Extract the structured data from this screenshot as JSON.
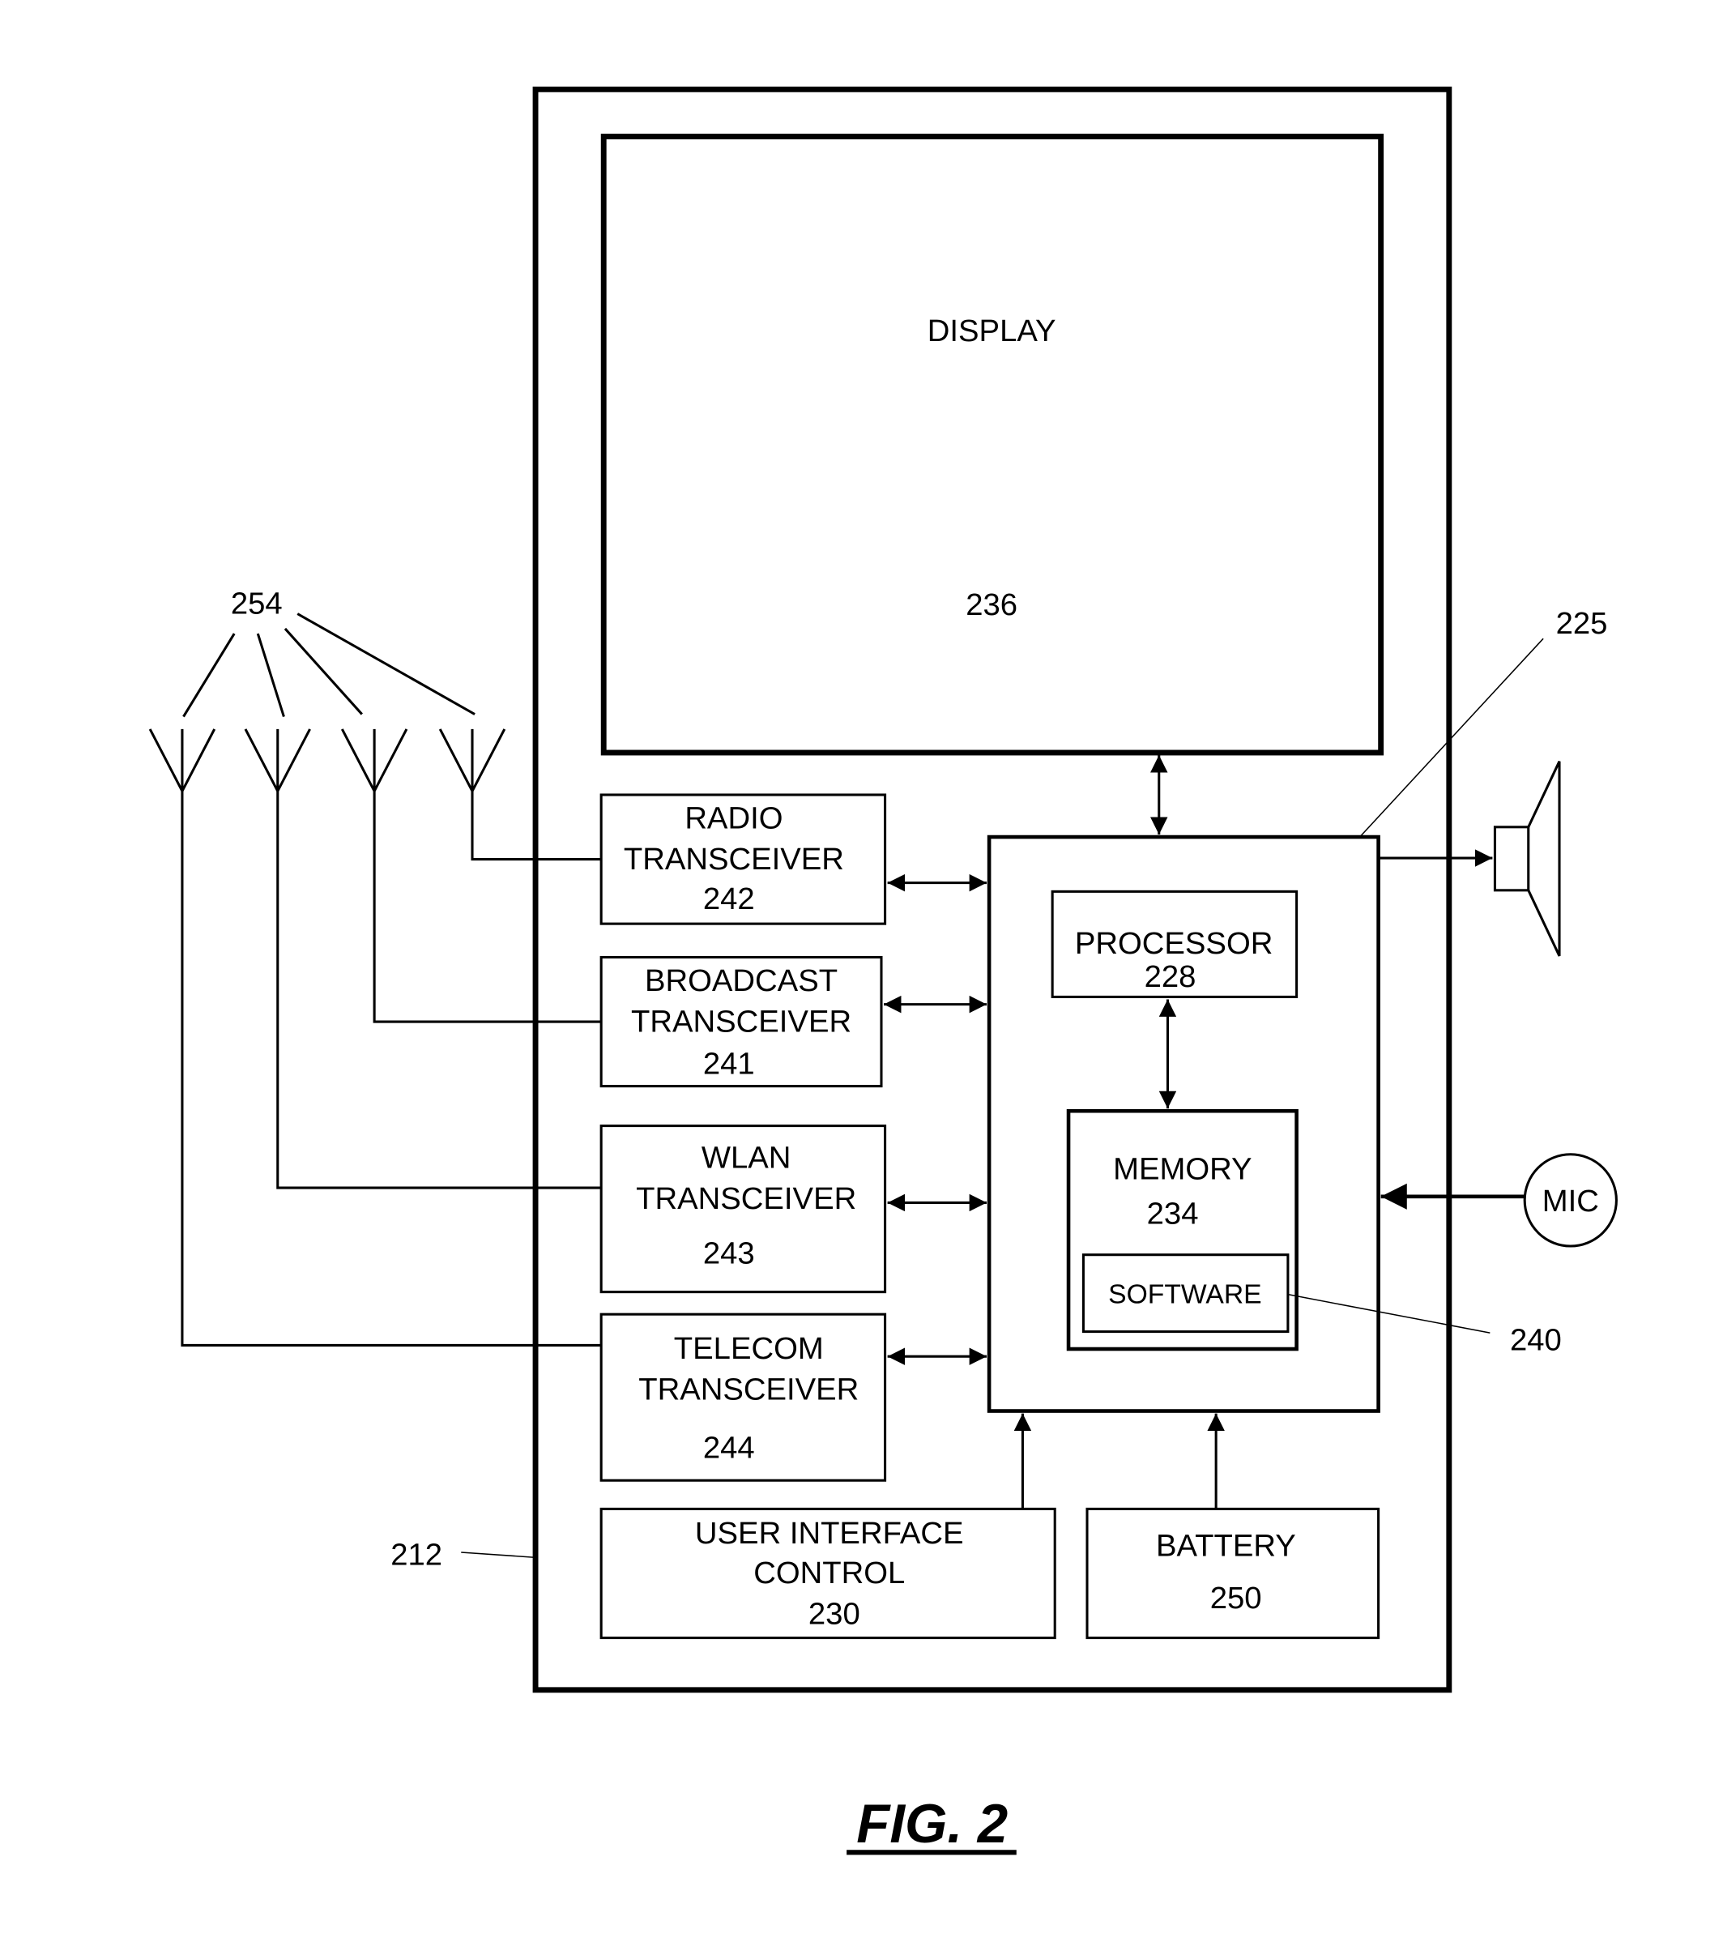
{
  "figure": {
    "caption": "FIG. 2",
    "device_ref": "212",
    "main_ref": "225",
    "antenna_ref": "254",
    "software_ref": "240"
  },
  "blocks": {
    "display": {
      "label": "DISPLAY",
      "ref": "236"
    },
    "radio": {
      "line1": "RADIO",
      "line2": "TRANSCEIVER",
      "ref": "242"
    },
    "broadcast": {
      "line1": "BROADCAST",
      "line2": "TRANSCEIVER",
      "ref": "241"
    },
    "wlan": {
      "line1": "WLAN",
      "line2": "TRANSCEIVER",
      "ref": "243"
    },
    "telecom": {
      "line1": "TELECOM",
      "line2": "TRANSCEIVER",
      "ref": "244"
    },
    "processor": {
      "label": "PROCESSOR",
      "ref": "228"
    },
    "memory": {
      "label": "MEMORY",
      "ref": "234"
    },
    "software": {
      "label": "SOFTWARE"
    },
    "ui_control": {
      "line1": "USER INTERFACE",
      "line2": "CONTROL",
      "ref": "230"
    },
    "battery": {
      "label": "BATTERY",
      "ref": "250"
    },
    "mic": {
      "label": "MIC"
    }
  }
}
